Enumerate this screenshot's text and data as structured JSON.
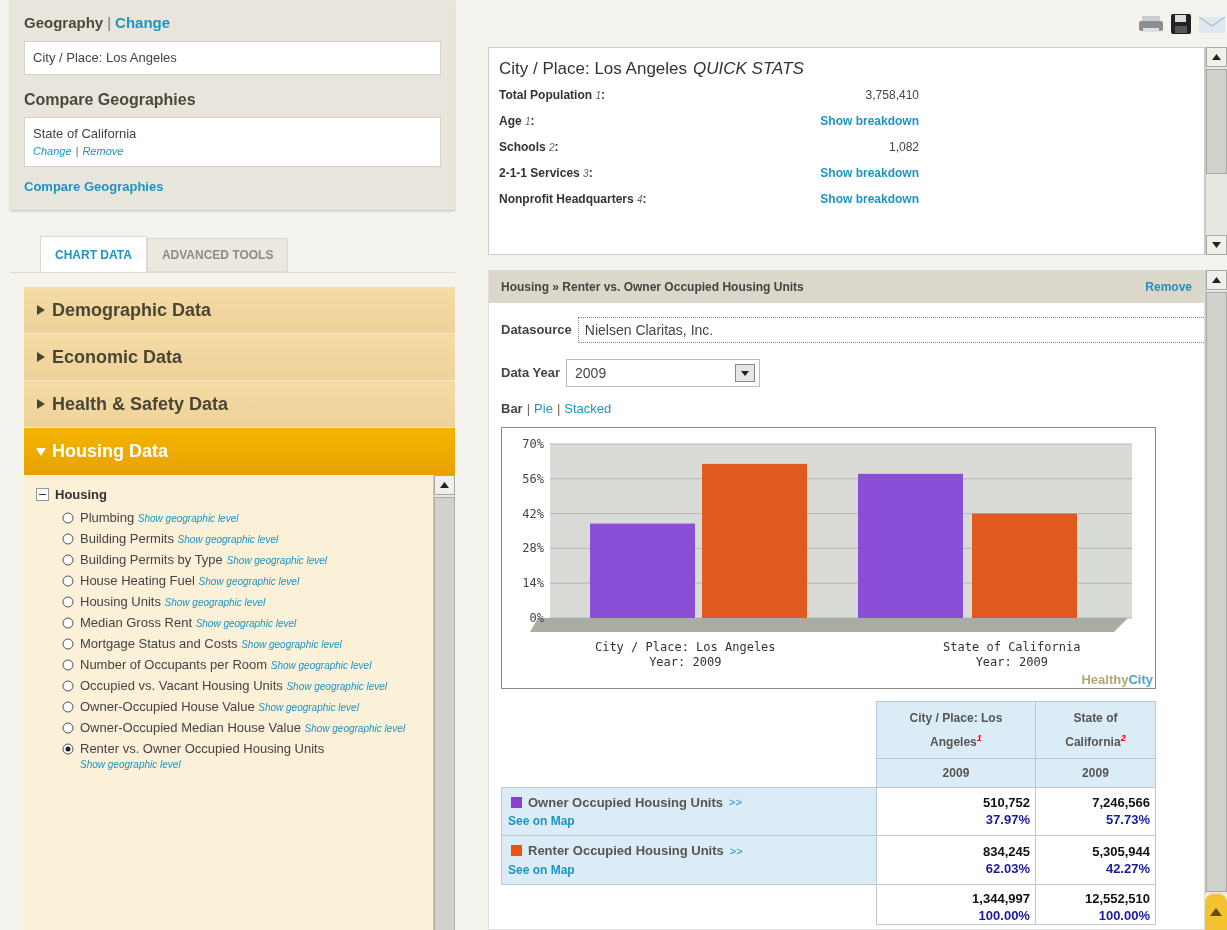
{
  "geography": {
    "title": "Geography",
    "separator": "|",
    "change_link": "Change",
    "value": "City / Place: Los Angeles"
  },
  "compare": {
    "title": "Compare Geographies",
    "value": "State of California",
    "change_link": "Change",
    "separator": "|",
    "remove_link": "Remove",
    "add_link": "Compare Geographies"
  },
  "tabs": [
    {
      "label": "CHART DATA",
      "selected": true
    },
    {
      "label": "ADVANCED TOOLS",
      "selected": false
    }
  ],
  "categories": [
    {
      "label": "Demographic Data",
      "expanded": false
    },
    {
      "label": "Economic Data",
      "expanded": false
    },
    {
      "label": "Health & Safety Data",
      "expanded": false
    },
    {
      "label": "Housing Data",
      "expanded": true
    }
  ],
  "tree": {
    "label": "Housing",
    "expanded": true,
    "items": [
      {
        "label": "Plumbing",
        "link": "Show geographic level",
        "selected": false
      },
      {
        "label": "Building Permits",
        "link": "Show geographic level",
        "selected": false
      },
      {
        "label": "Building Permits by Type",
        "link": "Show geographic level",
        "selected": false
      },
      {
        "label": "House Heating Fuel",
        "link": "Show geographic level",
        "selected": false
      },
      {
        "label": "Housing Units",
        "link": "Show geographic level",
        "selected": false
      },
      {
        "label": "Median Gross Rent",
        "link": "Show geographic level",
        "selected": false
      },
      {
        "label": "Mortgage Status and Costs",
        "link": "Show geographic level",
        "selected": false
      },
      {
        "label": "Number of Occupants per Room",
        "link": "Show geographic level",
        "selected": false
      },
      {
        "label": "Occupied vs. Vacant Housing Units",
        "link": "Show geographic level",
        "selected": false
      },
      {
        "label": "Owner-Occupied House Value",
        "link": "Show geographic level",
        "selected": false
      },
      {
        "label": "Owner-Occupied Median House Value",
        "link": "Show geographic level",
        "selected": false
      },
      {
        "label": "Renter vs. Owner Occupied Housing Units",
        "link": "Show geographic level",
        "selected": true
      }
    ]
  },
  "quick_stats": {
    "title": "City / Place: Los Angeles",
    "title_suffix": "QUICK STATS",
    "rows": [
      {
        "label": "Total Population",
        "note": "1",
        "colon": ":",
        "kind": "value",
        "value": "3,758,410"
      },
      {
        "label": "Age",
        "note": "1",
        "colon": ":",
        "kind": "link",
        "value": "Show breakdown"
      },
      {
        "label": "Schools",
        "note": "2",
        "colon": ":",
        "kind": "value",
        "value": "1,082"
      },
      {
        "label": "2-1-1 Services",
        "note": "3",
        "colon": ":",
        "kind": "link",
        "value": "Show breakdown"
      },
      {
        "label": "Nonprofit Headquarters",
        "note": "4",
        "colon": ":",
        "kind": "link",
        "value": "Show breakdown"
      }
    ]
  },
  "panel": {
    "title": "Housing » Renter vs. Owner Occupied Housing Units",
    "remove_link": "Remove",
    "datasource_label": "Datasource",
    "datasource": "Nielsen Claritas, Inc.",
    "year_label": "Data Year",
    "year": "2009",
    "chart_type_separator": "|",
    "chart_types": [
      {
        "label": "Bar",
        "selected": true
      },
      {
        "label": "Pie",
        "selected": false
      },
      {
        "label": "Stacked",
        "selected": false
      }
    ],
    "chart_data": {
      "type": "bar",
      "categories": [
        "City / Place: Los Angeles\nYear: 2009",
        "State of California\nYear: 2009"
      ],
      "series": [
        {
          "color": "#8a4fd6",
          "values": [
            38,
            58
          ]
        },
        {
          "color": "#e05a20",
          "values": [
            62,
            42
          ]
        }
      ],
      "ylim": [
        0,
        70
      ],
      "grid": true,
      "yticks": [
        {
          "value": 0,
          "label": "0%"
        },
        {
          "value": 14,
          "label": "14%"
        },
        {
          "value": 28,
          "label": "28%"
        },
        {
          "value": 42,
          "label": "42%"
        },
        {
          "value": 56,
          "label": "56%"
        },
        {
          "value": 70,
          "label": "70%"
        }
      ]
    },
    "logo": {
      "part1": "Healthy",
      "part2": "City"
    },
    "table": {
      "columns": [
        "City / Place: Los Angeles$^{1}$",
        "State of California$^{2}$"
      ],
      "years": [
        "2009",
        "2009"
      ],
      "rows": [
        {
          "label": "Owner Occupied Housing Units",
          "more": ">>",
          "map_link": "See on Map",
          "color": "#8a3fd0",
          "values": [
            {
              "count": "510,752",
              "percent": "37.97%"
            },
            {
              "count": "7,246,566",
              "percent": "57.73%"
            }
          ]
        },
        {
          "label": "Renter Occupied Housing Units",
          "more": ">>",
          "map_link": "See on Map",
          "color": "#f05010",
          "values": [
            {
              "count": "834,245",
              "percent": "62.03%"
            },
            {
              "count": "5,305,944",
              "percent": "42.27%"
            }
          ]
        }
      ],
      "totals": [
        {
          "count": "1,344,997",
          "percent": "100.00%"
        },
        {
          "count": "12,552,510",
          "percent": "100.00%"
        }
      ]
    }
  }
}
